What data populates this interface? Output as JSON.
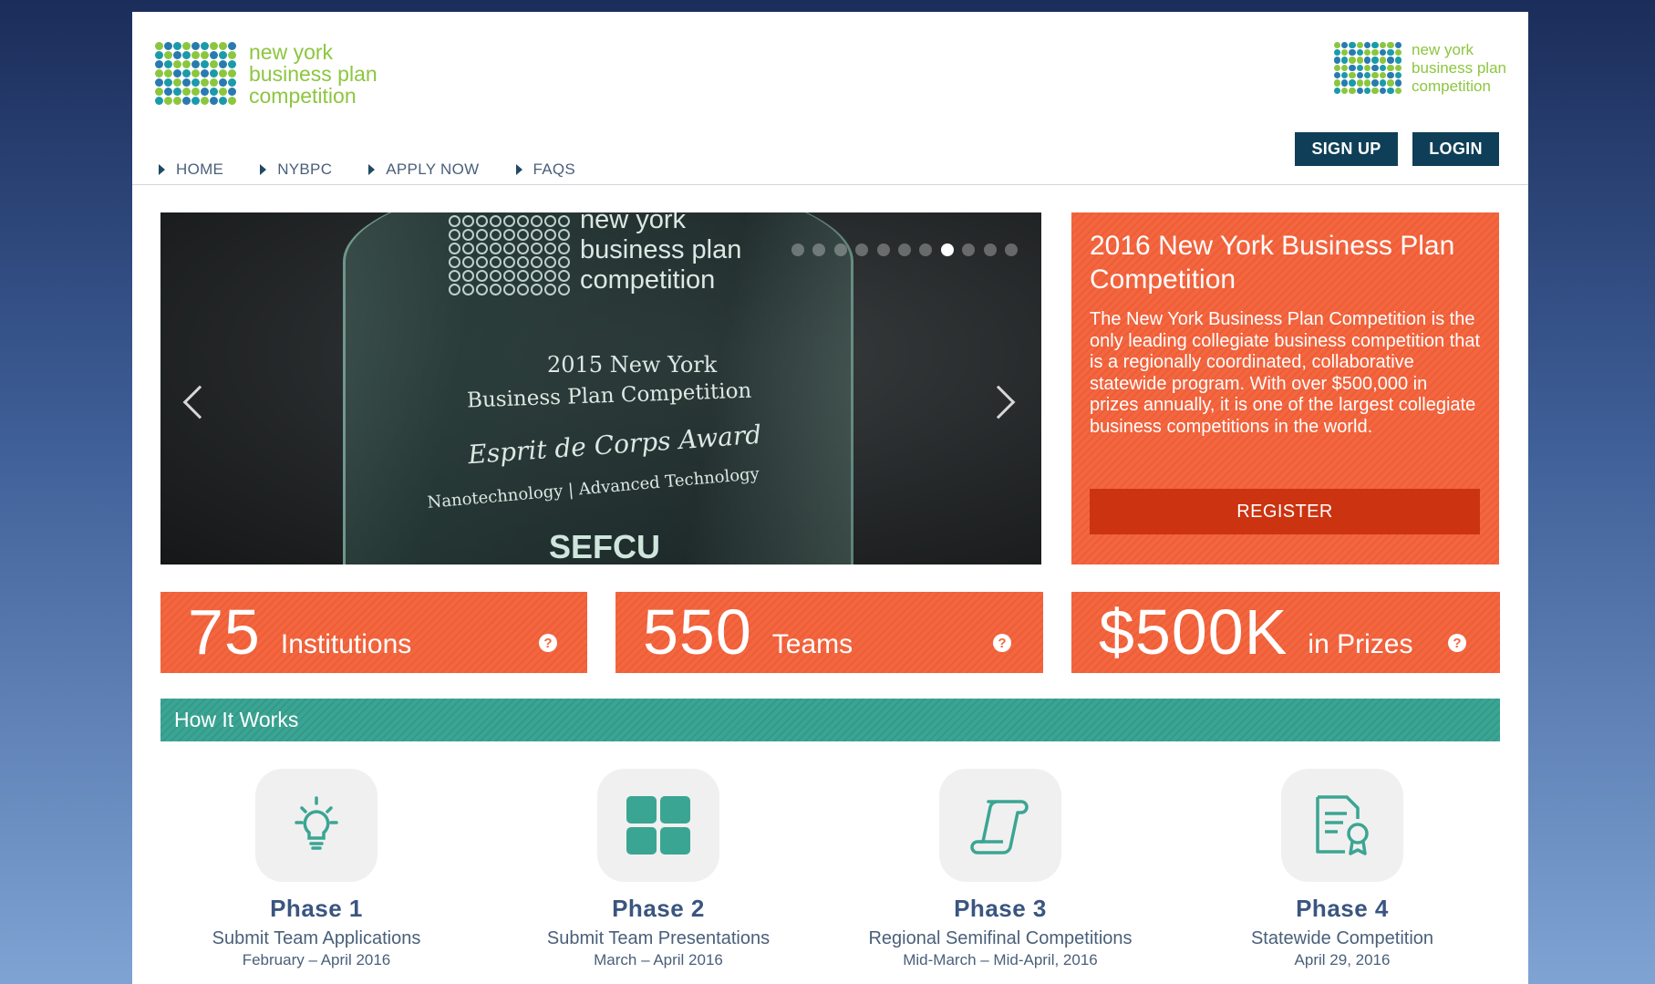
{
  "brand": {
    "name_line1": "new york",
    "name_line2": "business plan",
    "name_line3": "competition",
    "colors": {
      "green": "#8cc63f",
      "teal": "#1b9aaa",
      "blue": "#2a7ab0"
    }
  },
  "nav": {
    "items": [
      {
        "label": "HOME"
      },
      {
        "label": "NYBPC"
      },
      {
        "label": "APPLY NOW"
      },
      {
        "label": "FAQS"
      }
    ]
  },
  "auth": {
    "signup_label": "SIGN UP",
    "login_label": "LOGIN"
  },
  "slider": {
    "slide_logo_line1": "new york",
    "slide_logo_line2": "business plan",
    "slide_logo_line3": "competition",
    "award_line1": "2015 New York",
    "award_line2": "Business Plan Competition",
    "award_title": "Esprit de Corps Award",
    "award_category": "Nanotechnology | Advanced Technology",
    "sponsor": "SEFCU",
    "indicator_count": 11,
    "active_indicator": 8
  },
  "promo": {
    "title": "2016 New York Business Plan Competition",
    "body": "The New York Business Plan Competition is the only leading collegiate business competition that is a regionally coordinated, collaborative statewide program. With over $500,000 in prizes annually, it is one of the largest collegiate business competitions in the world.",
    "register_label": "REGISTER"
  },
  "stats": [
    {
      "number": "75",
      "label": "Institutions",
      "help": "?"
    },
    {
      "number": "550",
      "label": "Teams",
      "help": "?"
    },
    {
      "number": "$500K",
      "label": "in Prizes",
      "help": "?"
    }
  ],
  "how_it_works": {
    "heading": "How It Works",
    "phases": [
      {
        "title": "Phase 1",
        "desc": "Submit Team Applications",
        "date": "February – April 2016",
        "icon": "lightbulb-icon"
      },
      {
        "title": "Phase 2",
        "desc": "Submit Team Presentations",
        "date": "March – April 2016",
        "icon": "grid-icon"
      },
      {
        "title": "Phase 3",
        "desc": "Regional Semifinal Competitions",
        "date": "Mid-March – Mid-April, 2016",
        "icon": "scroll-icon"
      },
      {
        "title": "Phase 4",
        "desc": "Statewide Competition",
        "date": "April 29, 2016",
        "icon": "certificate-icon"
      }
    ]
  }
}
